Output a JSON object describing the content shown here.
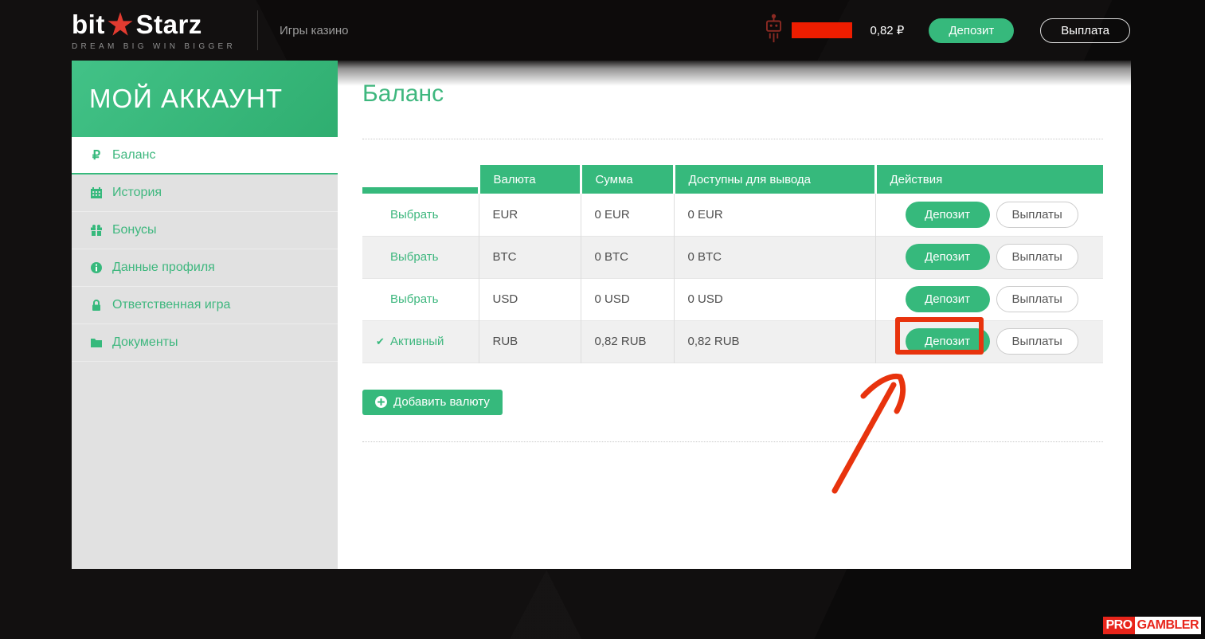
{
  "header": {
    "logo": {
      "bit": "bit",
      "star": "★",
      "starz": "Starz",
      "tagline": "DREAM BIG  WIN BIGGER"
    },
    "nav_games": "Игры казино",
    "balance": "0,82 ₽",
    "deposit_label": "Депозит",
    "payout_label": "Выплата"
  },
  "sidebar": {
    "title": "МОЙ АККАУНТ",
    "items": [
      {
        "label": "Баланс",
        "icon": "ruble-icon",
        "active": true
      },
      {
        "label": "История",
        "icon": "calendar-icon",
        "active": false
      },
      {
        "label": "Бонусы",
        "icon": "gift-icon",
        "active": false
      },
      {
        "label": "Данные профиля",
        "icon": "info-icon",
        "active": false
      },
      {
        "label": "Ответственная игра",
        "icon": "lock-icon",
        "active": false
      },
      {
        "label": "Документы",
        "icon": "folder-icon",
        "active": false
      }
    ]
  },
  "main": {
    "title": "Баланс",
    "table": {
      "headers": [
        "",
        "Валюта",
        "Сумма",
        "Доступны для вывода",
        "Действия"
      ],
      "rows": [
        {
          "select": "Выбрать",
          "currency": "EUR",
          "amount": "0 EUR",
          "available": "0 EUR",
          "deposit": "Депозит",
          "payouts": "Выплаты",
          "active": false,
          "highlighted": false
        },
        {
          "select": "Выбрать",
          "currency": "BTC",
          "amount": "0 BTC",
          "available": "0 BTC",
          "deposit": "Депозит",
          "payouts": "Выплаты",
          "active": false,
          "highlighted": false
        },
        {
          "select": "Выбрать",
          "currency": "USD",
          "amount": "0 USD",
          "available": "0 USD",
          "deposit": "Депозит",
          "payouts": "Выплаты",
          "active": false,
          "highlighted": false
        },
        {
          "select": "Активный",
          "currency": "RUB",
          "amount": "0,82 RUB",
          "available": "0,82 RUB",
          "deposit": "Депозит",
          "payouts": "Выплаты",
          "active": true,
          "highlighted": true
        }
      ]
    },
    "add_currency_label": "Добавить валюту",
    "check_glyph": "✔"
  },
  "watermark": {
    "pro": "PRO",
    "gambler": "GAMBLER"
  },
  "colors": {
    "green": "#36b97c",
    "annotation_red": "#e8330d",
    "background_dark": "#0d0b0b"
  }
}
